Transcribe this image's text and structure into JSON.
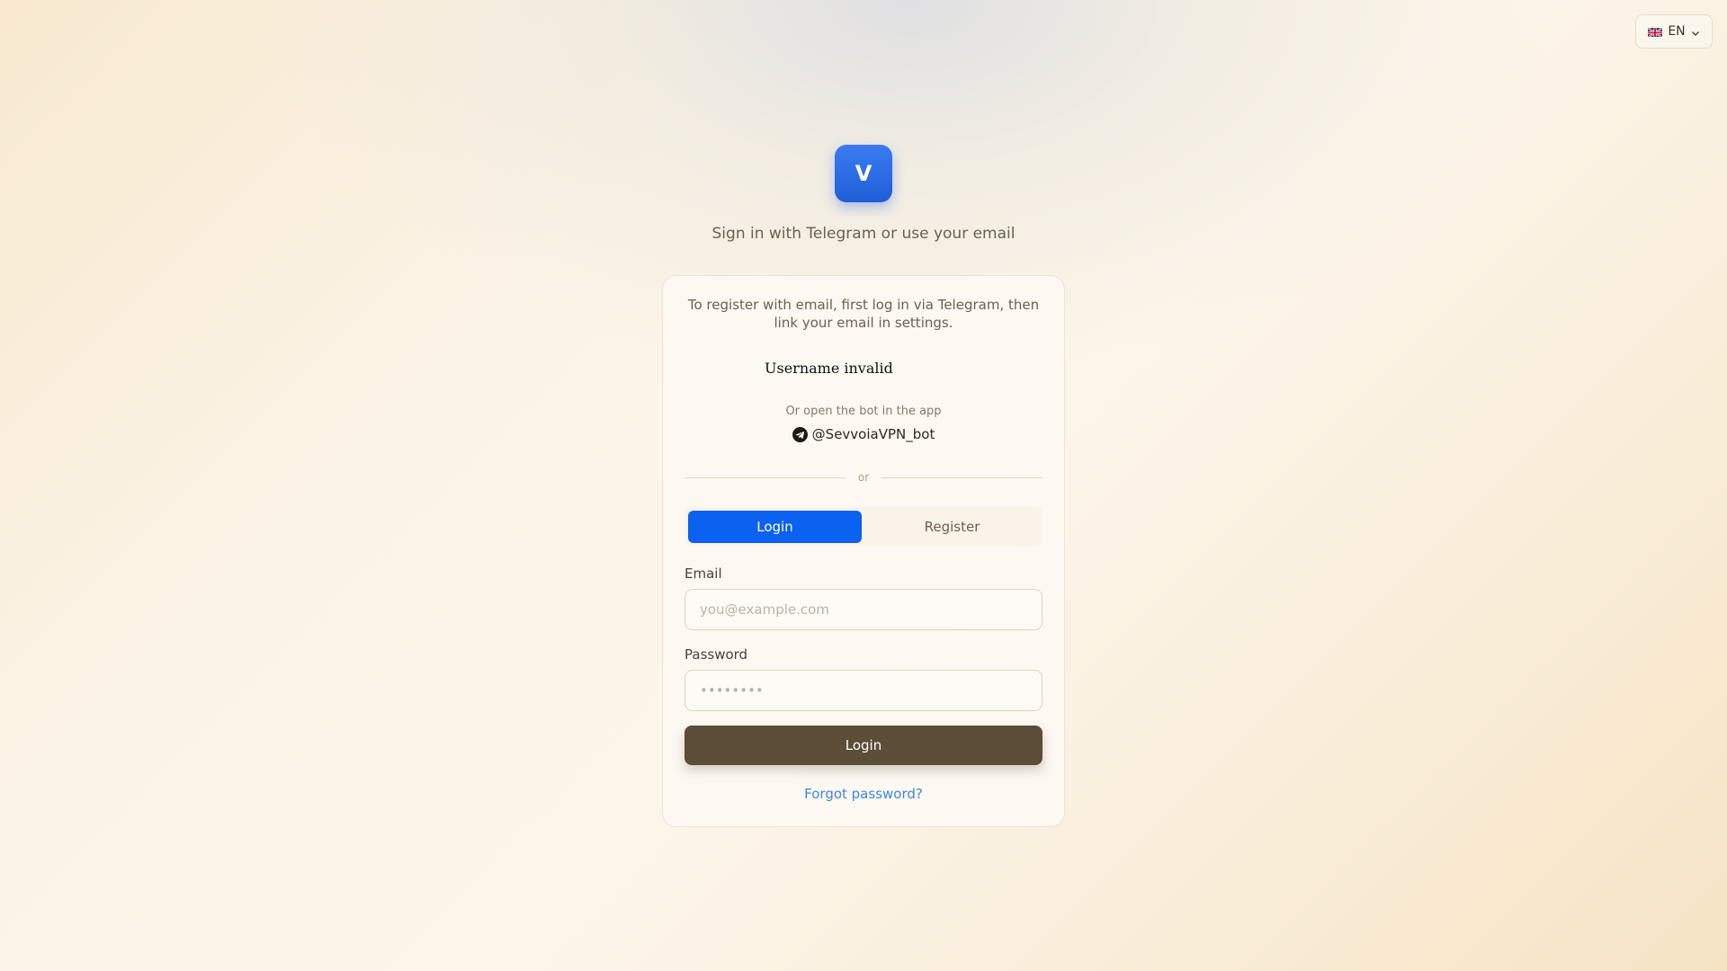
{
  "language": {
    "code": "EN",
    "flag_icon": "uk-flag-icon"
  },
  "header": {
    "logo_letter": "V",
    "subtitle": "Sign in with Telegram or use your email"
  },
  "card": {
    "notice": "To register with email, first log in via Telegram, then link your email in settings.",
    "telegram_widget_error": "Username invalid",
    "open_bot_text": "Or open the bot in the app",
    "bot_handle": "@SevvoiaVPN_bot",
    "divider_text": "or",
    "tabs": [
      {
        "label": "Login",
        "active": true
      },
      {
        "label": "Register",
        "active": false
      }
    ],
    "email": {
      "label": "Email",
      "placeholder": "you@example.com",
      "value": ""
    },
    "password": {
      "label": "Password",
      "placeholder": "••••••••",
      "value": ""
    },
    "submit_label": "Login",
    "forgot_label": "Forgot password?"
  },
  "colors": {
    "accent": "#0b61f0",
    "submit": "#5c4e36",
    "link": "#3d86e0"
  }
}
